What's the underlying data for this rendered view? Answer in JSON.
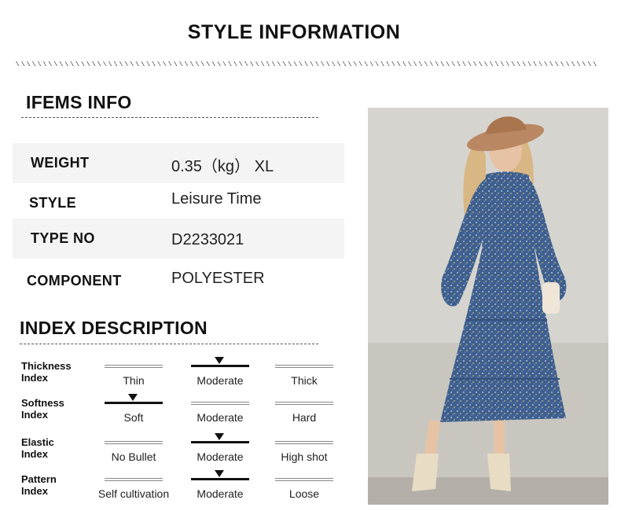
{
  "header": {
    "title": "STYLE INFORMATION"
  },
  "items_info": {
    "title": "IFEMS INFO",
    "rows": [
      {
        "label": "WEIGHT",
        "value": "0.35（kg） XL"
      },
      {
        "label": "STYLE",
        "value": "Leisure Time"
      },
      {
        "label": "TYPE NO",
        "value": "D2233021"
      },
      {
        "label": "COMPONENT",
        "value": "POLYESTER"
      }
    ]
  },
  "index_description": {
    "title": "INDEX DESCRIPTION",
    "rows": [
      {
        "label_line1": "Thickness",
        "label_line2": "Index",
        "options": [
          "Thin",
          "Moderate",
          "Thick"
        ],
        "selected": 1
      },
      {
        "label_line1": "Softness",
        "label_line2": "Index",
        "options": [
          "Soft",
          "Moderate",
          "Hard"
        ],
        "selected": 0
      },
      {
        "label_line1": "Elastic",
        "label_line2": "Index",
        "options": [
          "No Bullet",
          "Moderate",
          "High shot"
        ],
        "selected": 1
      },
      {
        "label_line1": "Pattern",
        "label_line2": "Index",
        "options": [
          "Self cultivation",
          "Moderate",
          "Loose"
        ],
        "selected": 1
      }
    ]
  },
  "colors": {
    "dress": "#3f5f8f",
    "hat": "#b98762",
    "wall": "#dcdad6",
    "ground": "#bdbab5"
  }
}
